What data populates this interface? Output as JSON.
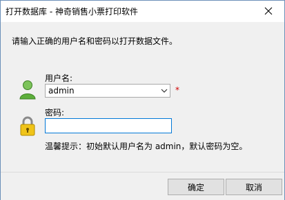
{
  "window": {
    "title": "打开数据库 - 神奇销售小票打印软件"
  },
  "instruction": "请输入正确的用户名和密码以打开数据文件。",
  "username": {
    "label": "用户名:",
    "value": "admin",
    "required_mark": "*"
  },
  "password": {
    "label": "密码:",
    "value": ""
  },
  "hint": "温馨提示：初始默认用户名为 admin，默认密码为空。",
  "buttons": {
    "ok": "确定",
    "cancel": "取消"
  },
  "icons": {
    "close": "close-icon",
    "user": "user-icon",
    "lock": "lock-icon",
    "dropdown": "chevron-down-icon"
  },
  "colors": {
    "required": "#d00000",
    "focus_border": "#0078d7",
    "user_icon": "#5cae3a",
    "lock_icon": "#e6b800"
  }
}
